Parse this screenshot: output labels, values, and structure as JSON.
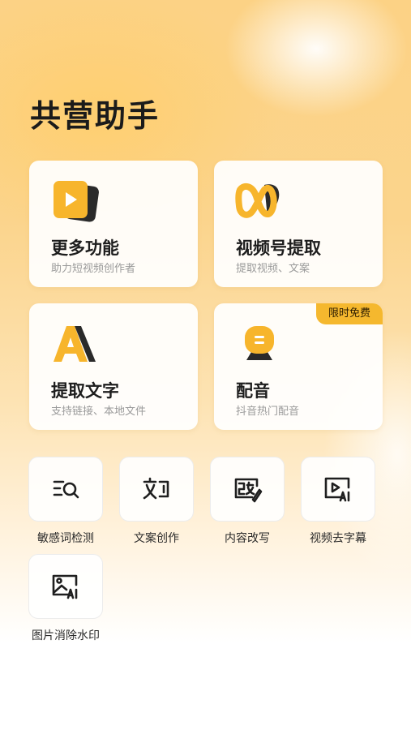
{
  "app": {
    "title": "共营助手"
  },
  "cards": [
    {
      "title": "更多功能",
      "subtitle": "助力短视频创作者",
      "icon": "video-card-icon"
    },
    {
      "title": "视频号提取",
      "subtitle": "提取视频、文案",
      "icon": "infinity-ribbon-icon"
    },
    {
      "title": "提取文字",
      "subtitle": "支持链接、本地文件",
      "icon": "letter-a-icon"
    },
    {
      "title": "配音",
      "subtitle": "抖音热门配音",
      "badge": "限时免费",
      "icon": "voice-bubble-icon"
    }
  ],
  "tools": [
    {
      "label": "敏感词检测",
      "icon": "search-list-icon"
    },
    {
      "label": "文案创作",
      "icon": "text-edit-icon"
    },
    {
      "label": "内容改写",
      "icon": "rewrite-icon"
    },
    {
      "label": "视频去字幕",
      "icon": "video-ai-icon"
    },
    {
      "label": "图片消除水印",
      "icon": "image-ai-icon"
    }
  ],
  "colors": {
    "accent": "#f5b82e",
    "accent_dark": "#1f1f1f",
    "text_primary": "#1d1d1d",
    "text_secondary": "#9a9a9a"
  }
}
